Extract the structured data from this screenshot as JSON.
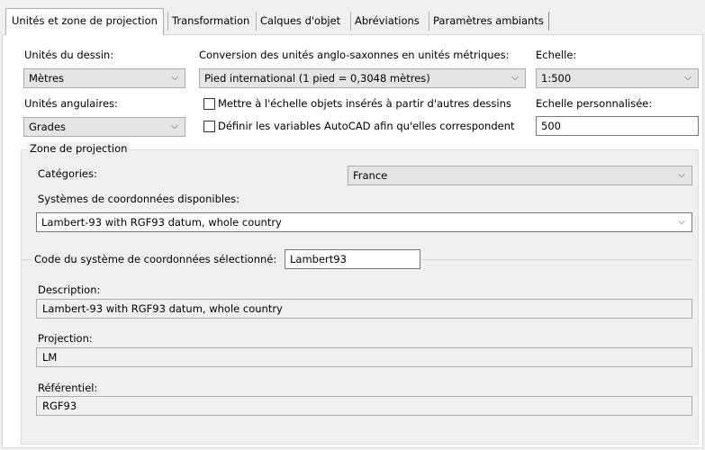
{
  "tabs": [
    {
      "label": "Unités et zone de projection",
      "active": true
    },
    {
      "label": "Transformation",
      "active": false
    },
    {
      "label": "Calques d'objet",
      "active": false
    },
    {
      "label": "Abréviations",
      "active": false
    },
    {
      "label": "Paramètres ambiants",
      "active": false
    }
  ],
  "units": {
    "drawing_label": "Unités du dessin:",
    "drawing_value": "Mètres",
    "angular_label": "Unités angulaires:",
    "angular_value": "Grades"
  },
  "conversion": {
    "label": "Conversion des unités anglo-saxonnes en unités métriques:",
    "value": "Pied international (1 pied = 0,3048 mètres)",
    "scale_inserted_label": "Mettre à l'échelle objets insérés à partir d'autres dessins",
    "scale_inserted_checked": false,
    "autocad_vars_label": "Définir les variables AutoCAD afin qu'elles correspondent",
    "autocad_vars_checked": false
  },
  "scale": {
    "label": "Echelle:",
    "value": "1:500",
    "custom_label": "Echelle personnalisée:",
    "custom_value": "500"
  },
  "projection": {
    "group_title": "Zone de projection",
    "categories_label": "Catégories:",
    "categories_value": "France",
    "systems_label": "Systèmes de coordonnées disponibles:",
    "systems_value": "Lambert-93 with RGF93 datum, whole country",
    "code_label": "Code du système de coordonnées sélectionné:",
    "code_value": "Lambert93",
    "description_label": "Description:",
    "description_value": "Lambert-93 with RGF93 datum, whole country",
    "projection_label": "Projection:",
    "projection_value": "LM",
    "datum_label": "Référentiel:",
    "datum_value": "RGF93"
  },
  "icons": {
    "dropdown": "chevron-down-icon"
  }
}
